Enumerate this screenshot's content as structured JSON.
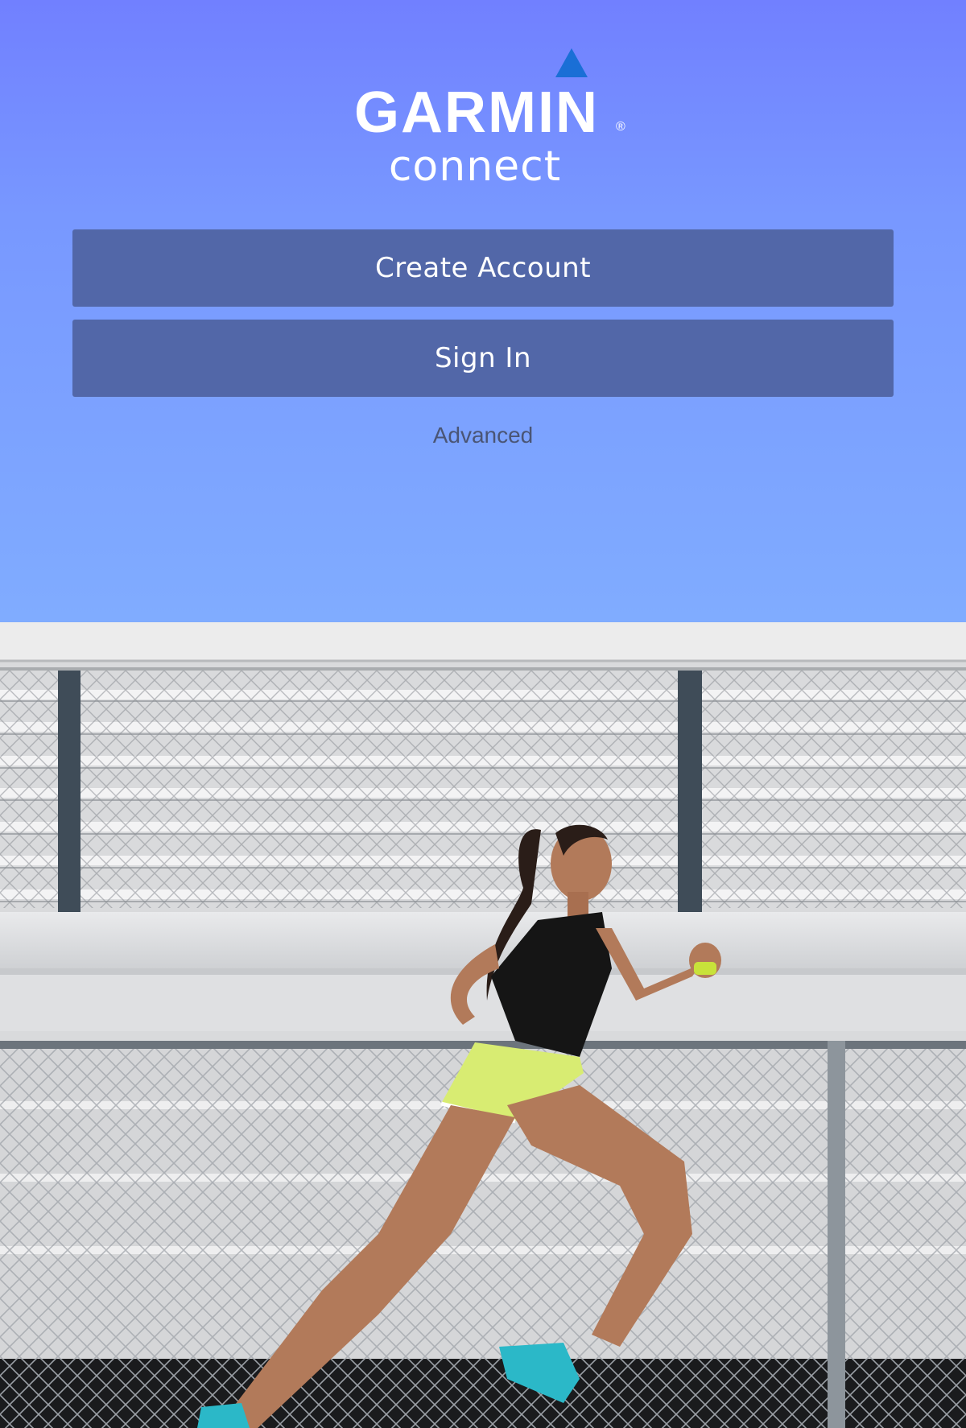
{
  "brand": {
    "logo_wordmark": "GARMIN",
    "logo_sub": "connect",
    "registered_mark": "®"
  },
  "actions": {
    "create_account_label": "Create Account",
    "sign_in_label": "Sign In",
    "advanced_label": "Advanced"
  },
  "hero_image": {
    "icon": "runner-photo",
    "description_visible": false
  },
  "colors": {
    "gradient_top": "#7180ff",
    "gradient_bottom": "#80acff",
    "button_bg": "#5267a8",
    "button_text": "#ffffff",
    "logo_triangle": "#1a6fd6"
  }
}
